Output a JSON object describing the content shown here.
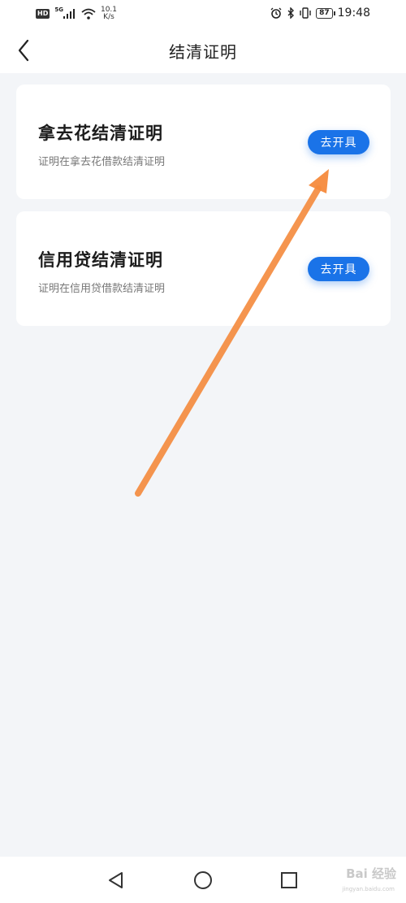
{
  "status_bar": {
    "hd_badge": "HD",
    "network": "5G",
    "speed_value": "10.1",
    "speed_unit": "K/s",
    "battery": "87",
    "time": "19:48"
  },
  "header": {
    "title": "结清证明"
  },
  "cards": [
    {
      "title": "拿去花结清证明",
      "subtitle": "证明在拿去花借款结清证明",
      "button_label": "去开具"
    },
    {
      "title": "信用贷结清证明",
      "subtitle": "证明在信用贷借款结清证明",
      "button_label": "去开具"
    }
  ],
  "colors": {
    "accent": "#1a73e8",
    "arrow": "#f58a3c",
    "background": "#f3f5f8"
  },
  "watermark": {
    "text": "Bai 经验",
    "subtext": "jingyan.baidu.com"
  }
}
